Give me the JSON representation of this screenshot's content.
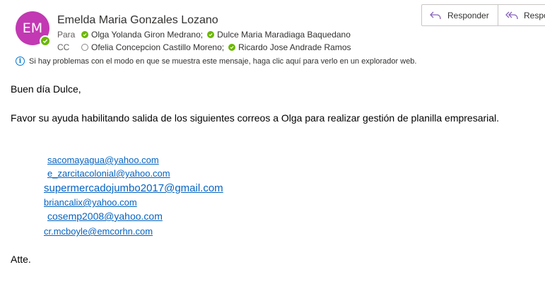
{
  "header": {
    "avatar_initials": "EM",
    "avatar_color": "#c239b3",
    "sender_name": "Emelda Maria Gonzales Lozano",
    "to_label": "Para",
    "to_recipients": [
      "Olga Yolanda Giron Medrano;",
      "Dulce Maria Maradiaga Baquedano"
    ],
    "cc_label": "CC",
    "cc_recipients": [
      "Ofelia Concepcion Castillo Moreno;",
      "Ricardo Jose Andrade Ramos"
    ],
    "status_available_color": "#6bb700"
  },
  "toolbar": {
    "reply_label": "Responder",
    "reply_all_label": "Responder a todos"
  },
  "info_bar": {
    "text": "Si hay problemas con el modo en que se muestra este mensaje, haga clic aquí para verlo en un explorador web."
  },
  "body": {
    "greeting": "Buen día Dulce,",
    "request": "Favor su ayuda habilitando salida de los siguientes correos a Olga para realizar gestión de planilla empresarial.",
    "emails": [
      "sacomayagua@yahoo.com",
      "e_zarcitacolonial@yahoo.com",
      "supermercadojumbo2017@gmail.com",
      "briancalix@yahoo.com",
      "cosemp2008@yahoo.com",
      "cr.mcboyle@emcorhn.com"
    ],
    "signoff": "Atte.",
    "link_color": "#0563c1"
  }
}
